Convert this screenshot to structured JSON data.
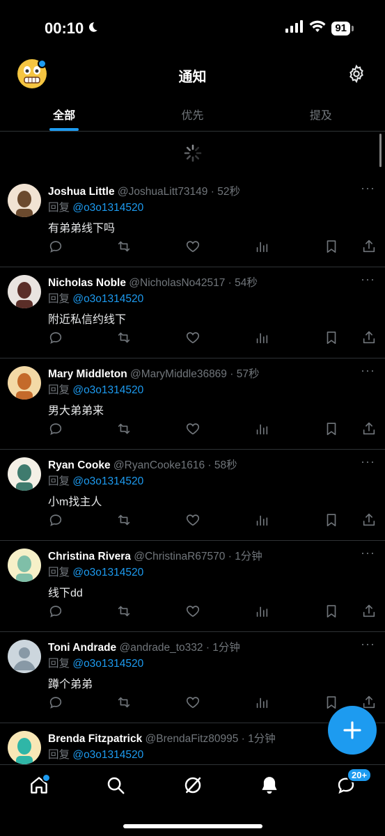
{
  "status_bar": {
    "time": "00:10",
    "battery": "91"
  },
  "header": {
    "title": "通知"
  },
  "tabs": [
    {
      "label": "全部",
      "active": true
    },
    {
      "label": "优先",
      "active": false
    },
    {
      "label": "提及",
      "active": false
    }
  ],
  "notifications": [
    {
      "name": "Joshua Little",
      "handle": "@JoshuaLitt73149",
      "time": "52秒",
      "reply_prefix": "回复",
      "reply_to": "@o3o1314520",
      "text": "有弟弟线下吗"
    },
    {
      "name": "Nicholas Noble",
      "handle": "@NicholasNo42517",
      "time": "54秒",
      "reply_prefix": "回复",
      "reply_to": "@o3o1314520",
      "text": "附近私信约线下"
    },
    {
      "name": "Mary Middleton",
      "handle": "@MaryMiddle36869",
      "time": "57秒",
      "reply_prefix": "回复",
      "reply_to": "@o3o1314520",
      "text": "男大弟弟来"
    },
    {
      "name": "Ryan Cooke",
      "handle": "@RyanCooke1616",
      "time": "58秒",
      "reply_prefix": "回复",
      "reply_to": "@o3o1314520",
      "text": "小m找主人"
    },
    {
      "name": "Christina Rivera",
      "handle": "@ChristinaR67570",
      "time": "1分钟",
      "reply_prefix": "回复",
      "reply_to": "@o3o1314520",
      "text": "线下dd"
    },
    {
      "name": "Toni Andrade",
      "handle": "@andrade_to332",
      "time": "1分钟",
      "reply_prefix": "回复",
      "reply_to": "@o3o1314520",
      "text": "蹲个弟弟"
    },
    {
      "name": "Brenda Fitzpatrick",
      "handle": "@BrendaFitz80995",
      "time": "1分钟",
      "reply_prefix": "回复",
      "reply_to": "@o3o1314520",
      "text": ""
    }
  ],
  "bottom_nav": {
    "messages_badge": "20+"
  },
  "colors": {
    "accent": "#1d9bf0",
    "background": "#000000",
    "muted": "#71767b",
    "divider": "#2f3336"
  }
}
